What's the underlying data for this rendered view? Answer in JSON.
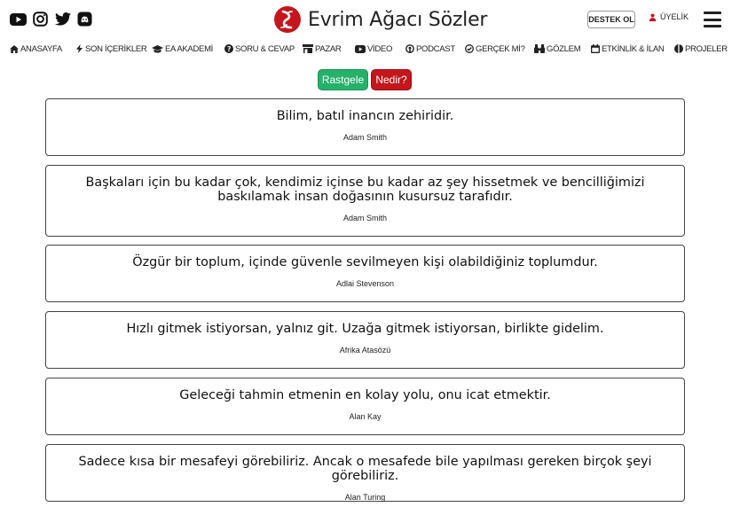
{
  "header": {
    "social_icons": [
      "youtube-icon",
      "instagram-icon",
      "twitter-icon",
      "discord-icon"
    ],
    "site_title": "Evrim Ağacı Sözler",
    "support_button": "DESTEK OL",
    "membership_label": "ÜYELİK",
    "menu_icon": "hamburger-menu-icon"
  },
  "nav": {
    "items": [
      {
        "icon": "home-icon",
        "label": "ANASAYFA"
      },
      {
        "icon": "bolt-icon",
        "label": "SON İÇERİKLER"
      },
      {
        "icon": "graduation-cap-icon",
        "label": "EA AKADEMİ"
      },
      {
        "icon": "question-circle-icon",
        "label": "SORU & CEVAP"
      },
      {
        "icon": "store-icon",
        "label": "PAZAR"
      },
      {
        "icon": "video-icon",
        "label": "VİDEO"
      },
      {
        "icon": "podcast-icon",
        "label": "PODCAST"
      },
      {
        "icon": "check-circle-icon",
        "label": "GERÇEK Mİ?"
      },
      {
        "icon": "binoculars-icon",
        "label": "GÖZLEM"
      },
      {
        "icon": "calendar-icon",
        "label": "ETKİNLİK & İLAN"
      },
      {
        "icon": "projects-icon",
        "label": "PROJELER"
      }
    ]
  },
  "actions": {
    "random_label": "Rastgele",
    "what_label": "Nedir?"
  },
  "quotes": [
    {
      "text": "Bilim, batıl inancın zehiridir.",
      "author": "Adam Smith"
    },
    {
      "text": "Başkaları için bu kadar çok, kendimiz içinse bu kadar az şey hissetmek ve bencilliğimizi baskılamak insan doğasının kusursuz tarafıdır.",
      "author": "Adam Smith"
    },
    {
      "text": "Özgür bir toplum, içinde güvenle sevilmeyen kişi olabildiğiniz toplumdur.",
      "author": "Adlai Stevenson"
    },
    {
      "text": "Hızlı gitmek istiyorsan, yalnız git. Uzağa gitmek istiyorsan, birlikte gidelim.",
      "author": "Afrika Atasözü"
    },
    {
      "text": "Geleceği tahmin etmenin en kolay yolu, onu icat etmektir.",
      "author": "Alan Kay"
    },
    {
      "text": "Sadece kısa bir mesafeyi görebiliriz. Ancak o mesafede bile yapılması gereken birçok şeyi görebiliriz.",
      "author": "Alan Turing"
    }
  ],
  "colors": {
    "brand_red": "#c4161c",
    "random_green": "#25b16a",
    "border": "#444444"
  }
}
